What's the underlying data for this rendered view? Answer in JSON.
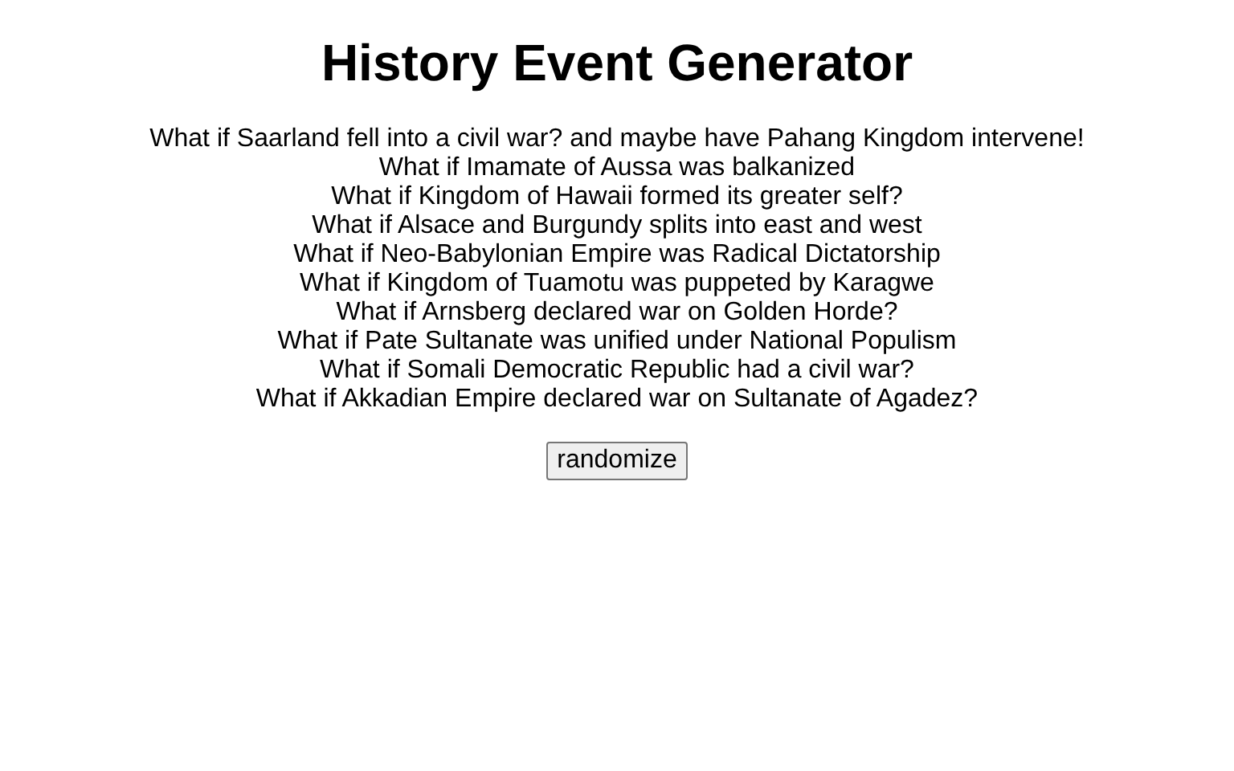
{
  "title": "History Event Generator",
  "events": [
    "What if Saarland fell into a civil war? and maybe have Pahang Kingdom intervene!",
    "What if Imamate of Aussa was balkanized",
    "What if Kingdom of Hawaii formed its greater self?",
    "What if Alsace and Burgundy splits into east and west",
    "What if Neo-Babylonian Empire was Radical Dictatorship",
    "What if Kingdom of Tuamotu was puppeted by Karagwe",
    "What if Arnsberg declared war on Golden Horde?",
    "What if Pate Sultanate was unified under National Populism",
    "What if Somali Democratic Republic had a civil war?",
    "What if Akkadian Empire declared war on Sultanate of Agadez?"
  ],
  "button": "randomize"
}
